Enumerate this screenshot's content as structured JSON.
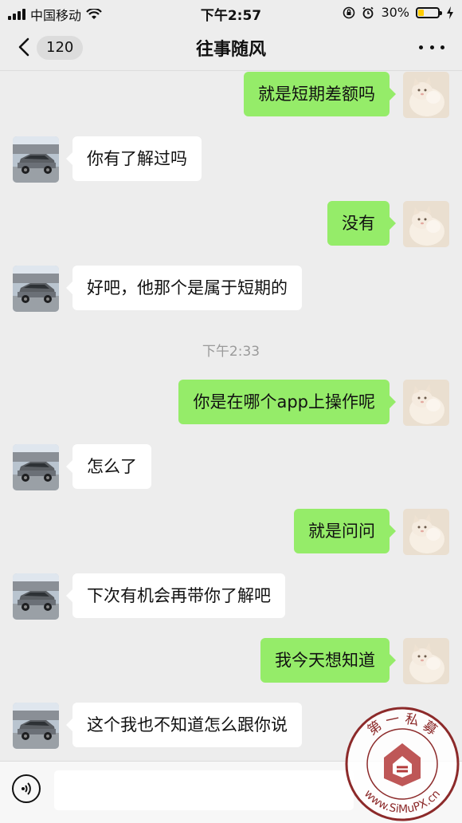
{
  "status_bar": {
    "carrier": "中国移动",
    "time": "下午2:57",
    "battery_percent": "30%",
    "battery_level": 0.3,
    "battery_color": "#ffcc00",
    "icons": [
      "signal-icon",
      "wifi-icon",
      "rotation-lock-icon",
      "alarm-icon",
      "battery-icon",
      "charging-icon"
    ]
  },
  "nav": {
    "back_icon": "chevron-left-icon",
    "unread_count": "120",
    "title": "往事随风",
    "more_icon": "more-dots-icon"
  },
  "messages": [
    {
      "side": "right",
      "text": "就是短期差额吗"
    },
    {
      "side": "left",
      "text": "你有了解过吗"
    },
    {
      "side": "right",
      "text": "没有"
    },
    {
      "side": "left",
      "text": "好吧，他那个是属于短期的"
    },
    {
      "side": "right",
      "text": "你是在哪个app上操作呢"
    },
    {
      "side": "left",
      "text": "怎么了"
    },
    {
      "side": "right",
      "text": "就是问问"
    },
    {
      "side": "left",
      "text": "下次有机会再带你了解吧"
    },
    {
      "side": "right",
      "text": "我今天想知道"
    },
    {
      "side": "left",
      "text": "这个我也不知道怎么跟你说"
    }
  ],
  "timestamp": "下午2:33",
  "input": {
    "voice_icon": "voice-icon",
    "placeholder": ""
  },
  "colors": {
    "background": "#ededed",
    "sent_bubble": "#95ec69",
    "received_bubble": "#ffffff",
    "timestamp_text": "#9a9a9a"
  },
  "watermark": {
    "text_top": "第 一 私 募",
    "text_bottom": "www.SiMuPX.cn"
  }
}
